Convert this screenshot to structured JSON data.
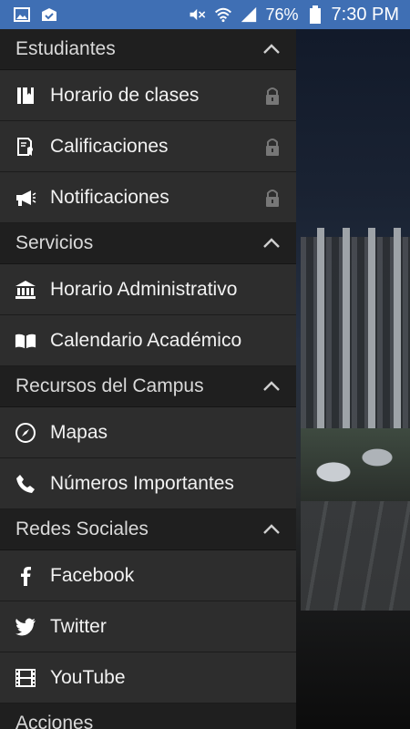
{
  "status_bar": {
    "battery_percent": "76%",
    "time": "7:30 PM",
    "icons": [
      "gallery-icon",
      "sync-icon",
      "mute-icon",
      "wifi-icon",
      "signal-icon",
      "battery-icon"
    ],
    "background_color": "#3f6fb4"
  },
  "drawer": {
    "sections": [
      {
        "title": "Estudiantes",
        "items": [
          {
            "label": "Horario de clases",
            "icon": "book-icon",
            "locked": true
          },
          {
            "label": "Calificaciones",
            "icon": "certificate-icon",
            "locked": true
          },
          {
            "label": "Notificaciones",
            "icon": "megaphone-icon",
            "locked": true
          }
        ]
      },
      {
        "title": "Servicios",
        "items": [
          {
            "label": "Horario Administrativo",
            "icon": "bank-icon",
            "locked": false
          },
          {
            "label": "Calendario Académico",
            "icon": "open-book-icon",
            "locked": false
          }
        ]
      },
      {
        "title": "Recursos del Campus",
        "items": [
          {
            "label": "Mapas",
            "icon": "compass-icon",
            "locked": false
          },
          {
            "label": "Números Importantes",
            "icon": "phone-icon",
            "locked": false
          }
        ]
      },
      {
        "title": "Redes Sociales",
        "items": [
          {
            "label": "Facebook",
            "icon": "facebook-icon",
            "locked": false
          },
          {
            "label": "Twitter",
            "icon": "twitter-icon",
            "locked": false
          },
          {
            "label": "YouTube",
            "icon": "film-icon",
            "locked": false
          }
        ]
      },
      {
        "title": "Acciones",
        "items": []
      }
    ]
  },
  "colors": {
    "drawer_bg": "#2d2d2d",
    "section_bg": "#1f1f1f",
    "text": "#f2f2f2"
  }
}
